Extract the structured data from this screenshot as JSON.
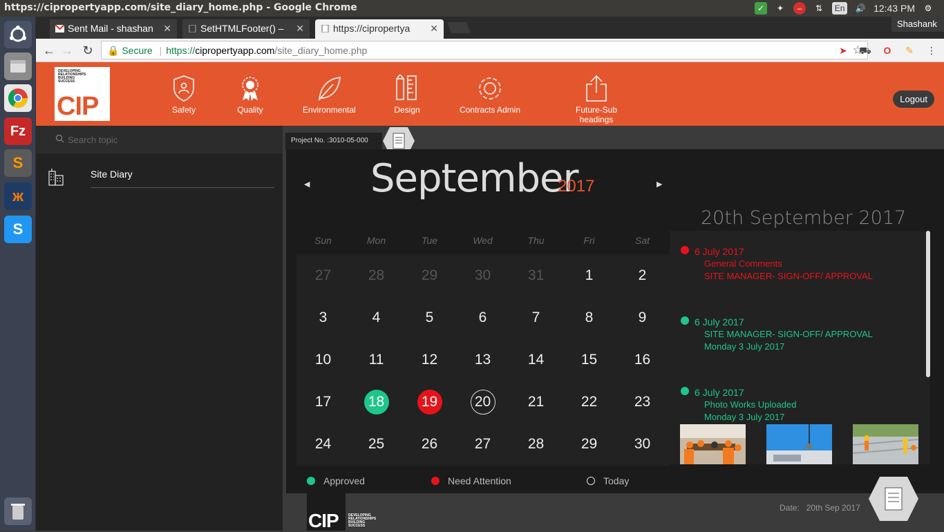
{
  "os": {
    "window_title": "https://cipropertyapp.com/site_diary_home.php - Google Chrome",
    "tray": {
      "keyboard": "En",
      "time": "12:43 PM"
    }
  },
  "browser": {
    "tabs": [
      {
        "label": "Sent Mail - shashan"
      },
      {
        "label": "SetHTMLFooter() –"
      },
      {
        "label": "https://cipropertya"
      }
    ],
    "profile": "Shashank",
    "secure_label": "Secure",
    "url_scheme": "https://",
    "url_host": "cipropertyapp.com",
    "url_path": "/site_diary_home.php"
  },
  "app": {
    "logo_tagline": [
      "DEVELOPING",
      "RELATIONSHIPS",
      "BUILDING",
      "SUCCESS"
    ],
    "logo_text": "CIP",
    "nav": [
      {
        "label": "Safety",
        "icon": "shield-icon"
      },
      {
        "label": "Quality",
        "icon": "award-icon"
      },
      {
        "label": "Environmental",
        "icon": "leaf-icon"
      },
      {
        "label": "Design",
        "icon": "pencil-ruler-icon"
      },
      {
        "label": "Contracts Admin",
        "icon": "gear-icon"
      },
      {
        "label": "Future-Sub headings",
        "icon": "share-icon"
      }
    ],
    "logout": "Logout"
  },
  "sidebar": {
    "search_placeholder": "Search topic",
    "items": [
      {
        "label": "Site Diary",
        "icon": "building-icon"
      }
    ]
  },
  "main": {
    "project_no": "Project No. :3010-05-000",
    "calendar": {
      "month": "September",
      "year": "2017",
      "days": [
        "Sun",
        "Mon",
        "Tue",
        "Wed",
        "Thu",
        "Fri",
        "Sat"
      ],
      "weeks": [
        [
          "27",
          "28",
          "29",
          "30",
          "31",
          "1",
          "2"
        ],
        [
          "3",
          "4",
          "5",
          "6",
          "7",
          "8",
          "9"
        ],
        [
          "10",
          "11",
          "12",
          "13",
          "14",
          "15",
          "16"
        ],
        [
          "17",
          "18",
          "19",
          "20",
          "21",
          "22",
          "23"
        ],
        [
          "24",
          "25",
          "26",
          "27",
          "28",
          "29",
          "30"
        ]
      ]
    },
    "selected_date": "20th September 2017",
    "events": [
      {
        "date": "6 July 2017",
        "line1": "General Comments",
        "line2": "SITE MANAGER- SIGN-OFF/ APPROVAL",
        "status": "red"
      },
      {
        "date": "6 July 2017",
        "line1": "SITE MANAGER- SIGN-OFF/ APPROVAL",
        "line2": "Monday 3 July 2017",
        "status": "green"
      },
      {
        "date": "6 July 2017",
        "line1": "Photo Works Uploaded",
        "line2": "Monday 3 July 2017",
        "status": "green"
      }
    ],
    "legend": {
      "approved": "Approved",
      "attention": "Need Attention",
      "today": "Today"
    },
    "colors": {
      "approved": "#1ec68a",
      "attention": "#e8131a",
      "accent": "#e4572e"
    }
  },
  "footer": {
    "logo_text": "CIP",
    "date_label": "Date:",
    "date_value": "20th Sep 2017"
  }
}
